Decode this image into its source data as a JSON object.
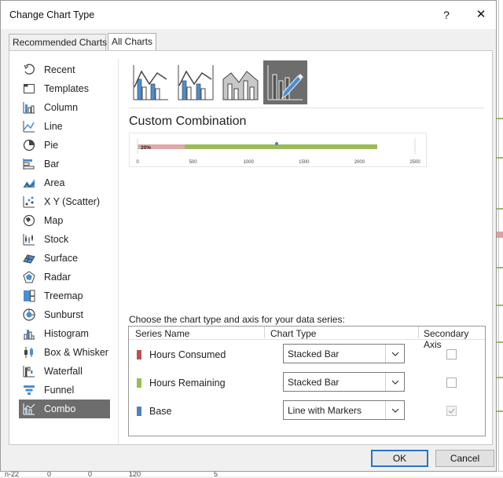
{
  "window": {
    "title": "Change Chart Type",
    "help_label": "?",
    "close_label": "✕"
  },
  "tabs": [
    {
      "label": "Recommended Charts",
      "active": false
    },
    {
      "label": "All Charts",
      "active": true
    }
  ],
  "sidebar": {
    "items": [
      {
        "label": "Recent",
        "icon": "recent-icon"
      },
      {
        "label": "Templates",
        "icon": "templates-icon"
      },
      {
        "label": "Column",
        "icon": "column-chart-icon"
      },
      {
        "label": "Line",
        "icon": "line-chart-icon"
      },
      {
        "label": "Pie",
        "icon": "pie-chart-icon"
      },
      {
        "label": "Bar",
        "icon": "bar-chart-icon"
      },
      {
        "label": "Area",
        "icon": "area-chart-icon"
      },
      {
        "label": "X Y (Scatter)",
        "icon": "scatter-chart-icon"
      },
      {
        "label": "Map",
        "icon": "map-chart-icon"
      },
      {
        "label": "Stock",
        "icon": "stock-chart-icon"
      },
      {
        "label": "Surface",
        "icon": "surface-chart-icon"
      },
      {
        "label": "Radar",
        "icon": "radar-chart-icon"
      },
      {
        "label": "Treemap",
        "icon": "treemap-chart-icon"
      },
      {
        "label": "Sunburst",
        "icon": "sunburst-chart-icon"
      },
      {
        "label": "Histogram",
        "icon": "histogram-chart-icon"
      },
      {
        "label": "Box & Whisker",
        "icon": "box-whisker-chart-icon"
      },
      {
        "label": "Waterfall",
        "icon": "waterfall-chart-icon"
      },
      {
        "label": "Funnel",
        "icon": "funnel-chart-icon"
      },
      {
        "label": "Combo",
        "icon": "combo-chart-icon",
        "selected": true
      }
    ]
  },
  "combo_subtypes": [
    {
      "name": "clustered-column-line",
      "selected": false
    },
    {
      "name": "clustered-column-line-secondary-axis",
      "selected": false
    },
    {
      "name": "stacked-area-clustered-column",
      "selected": false
    },
    {
      "name": "custom-combination",
      "selected": true
    }
  ],
  "main": {
    "subtitle": "Custom Combination",
    "preview": {
      "data_label": "20%",
      "axis_ticks": [
        "0",
        "500",
        "1000",
        "1500",
        "2000",
        "2500"
      ]
    },
    "series_prompt": "Choose the chart type and axis for your data series:",
    "columns": {
      "series_name": "Series Name",
      "chart_type": "Chart Type",
      "secondary_axis": "Secondary Axis"
    },
    "series": [
      {
        "name": "Hours Consumed",
        "color": "#c0504d",
        "chart_type": "Stacked Bar",
        "secondary_axis": false,
        "checkbox_enabled": true
      },
      {
        "name": "Hours Remaining",
        "color": "#9bbb59",
        "chart_type": "Stacked Bar",
        "secondary_axis": false,
        "checkbox_enabled": true
      },
      {
        "name": "Base",
        "color": "#4f81bd",
        "chart_type": "Line with Markers",
        "secondary_axis": false,
        "checkbox_enabled": false
      }
    ]
  },
  "footer": {
    "ok_label": "OK",
    "cancel_label": "Cancel"
  },
  "colors": {
    "accent": "#2a73c7",
    "selected_bg": "#6d6d6d"
  }
}
